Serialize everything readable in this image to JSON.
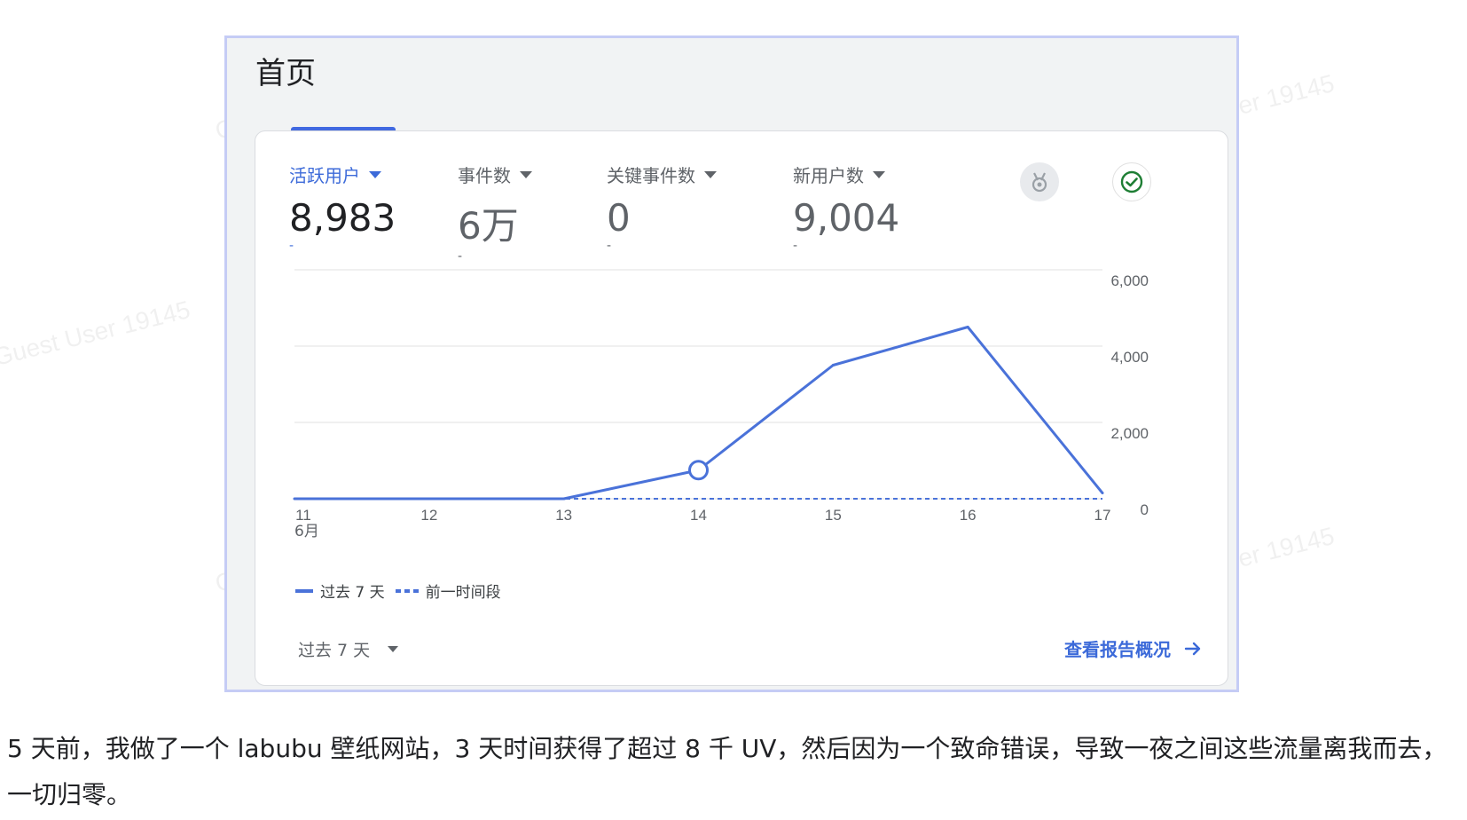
{
  "header": {
    "title": "首页"
  },
  "metrics": [
    {
      "label": "活跃用户",
      "value": "8,983",
      "change": "-"
    },
    {
      "label": "事件数",
      "value": "6万",
      "change": "-"
    },
    {
      "label": "关键事件数",
      "value": "0",
      "change": "-"
    },
    {
      "label": "新用户数",
      "value": "9,004",
      "change": "-"
    }
  ],
  "icons": {
    "insights": "medal-icon",
    "status": "check-circle-icon"
  },
  "colors": {
    "accent": "#3c6ad9",
    "line": "#4a72d9",
    "frame": "#c5ccf5"
  },
  "chart_data": {
    "type": "line",
    "x": [
      "11",
      "12",
      "13",
      "14",
      "15",
      "16",
      "17"
    ],
    "x_sub_label": "6月",
    "series": [
      {
        "name": "过去 7 天",
        "values": [
          0,
          0,
          0,
          750,
          3500,
          4500,
          150
        ]
      },
      {
        "name": "前一时间段",
        "values": [
          0,
          0,
          0,
          0,
          0,
          0,
          0
        ]
      }
    ],
    "y_ticks": [
      "6,000",
      "4,000",
      "2,000",
      "0"
    ],
    "ylim": [
      0,
      6000
    ],
    "highlight_index": 3,
    "y_axis_side": "right",
    "grid": true,
    "legend_position": "bottom-left"
  },
  "legend": {
    "current": "过去 7 天",
    "previous": "前一时间段"
  },
  "footer": {
    "date_range": "过去 7 天",
    "view_report": "查看报告概况"
  },
  "caption": "5 天前，我做了一个 labubu 壁纸网站，3 天时间获得了超过 8 千 UV，然后因为一个致命错误，导致一夜之间这些流量离我而去，一切归零。",
  "watermark": "Guest User 19145"
}
